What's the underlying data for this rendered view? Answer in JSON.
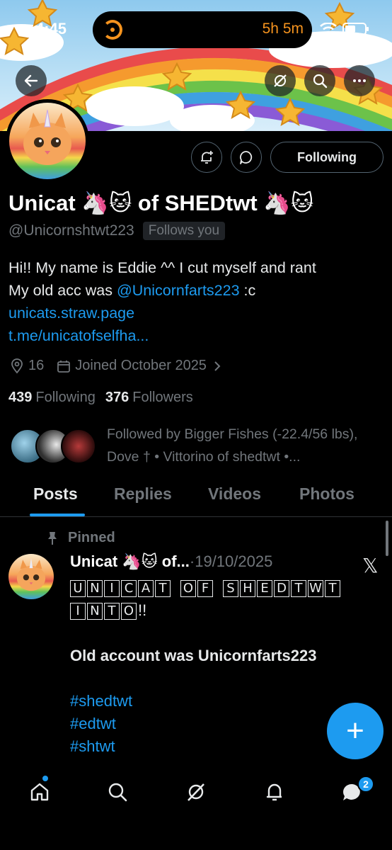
{
  "status_bar": {
    "time": "4:45",
    "timer": "5h 5m"
  },
  "profile": {
    "name": "Unicat 🦄🐱 of SHEDtwt 🦄🐱",
    "handle": "@Unicornshtwt223",
    "follows_you": "Follows you",
    "bio_line1": "Hi!! My name is Eddie ^^ I cut myself and rant",
    "bio_line2_prefix": "My old acc was ",
    "bio_mention": "@Unicornfarts223",
    "bio_line2_suffix": " :c",
    "link1": "unicats.straw.page",
    "link2": "t.me/unicatofselfha...",
    "location": "16",
    "joined": "Joined October 2025",
    "following_count": "439",
    "following_label": "Following",
    "followers_count": "376",
    "followers_label": "Followers",
    "followed_by": "Followed by Bigger Fishes (-22.4/56 lbs), Dove † • Vittorino of shedtwt •..."
  },
  "actions": {
    "following_button": "Following"
  },
  "tabs": [
    "Posts",
    "Replies",
    "Videos",
    "Photos"
  ],
  "post": {
    "pinned_label": "Pinned",
    "author": "Unicat 🦄🐱 of...",
    "date": "·19/10/2025",
    "boxed_line1": [
      "U",
      "N",
      "I",
      "C",
      "A",
      "T",
      " ",
      "O",
      "F",
      " ",
      "S",
      "H",
      "E",
      "D",
      "T",
      "W",
      "T"
    ],
    "boxed_line2": [
      "I",
      "N",
      "T",
      "O"
    ],
    "line2_suffix": "!!",
    "bold_line": "Old account was Unicornfarts223",
    "hashtags": [
      "#shedtwt",
      "#edtwt",
      "#shtwt"
    ]
  },
  "fab_label": "+",
  "nav": {
    "messages_badge": "2"
  },
  "icons": [
    "back-arrow-icon",
    "no-grok-icon",
    "search-icon",
    "more-icon",
    "bell-plus-icon",
    "message-bubble-icon",
    "location-icon",
    "calendar-icon",
    "pin-icon",
    "x-logo-icon",
    "home-icon",
    "grok-icon",
    "bell-icon",
    "chat-icon"
  ],
  "colors": {
    "accent": "#1d9bf0",
    "muted": "#71767b",
    "text": "#e7e9ea",
    "timer": "#f5931e"
  }
}
